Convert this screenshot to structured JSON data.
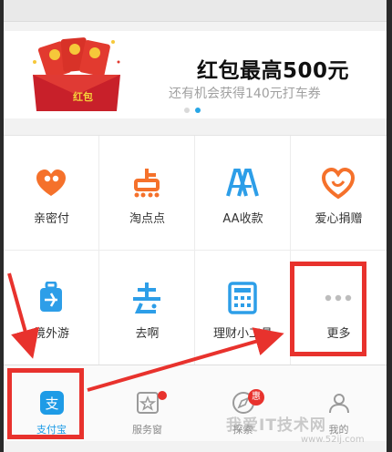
{
  "banner": {
    "title": "红包最高500元",
    "subtitle": "还有机会获得140元打车券",
    "redpack_label": "红包"
  },
  "grid": {
    "items": [
      {
        "label": "亲密付",
        "icon": "heart-people-icon",
        "color": "#f5712b"
      },
      {
        "label": "淘点点",
        "icon": "dianping-icon",
        "color": "#f5712b"
      },
      {
        "label": "AA收款",
        "icon": "aa-icon",
        "color": "#2d9ee8"
      },
      {
        "label": "爱心捐赠",
        "icon": "charity-heart-icon",
        "color": "#f5712b"
      },
      {
        "label": "境外游",
        "icon": "luggage-icon",
        "color": "#2d9ee8"
      },
      {
        "label": "去啊",
        "icon": "qua-icon",
        "color": "#2d9ee8"
      },
      {
        "label": "理财小工具",
        "icon": "calculator-icon",
        "color": "#2d9ee8"
      },
      {
        "label": "更多",
        "icon": "more-dots-icon",
        "color": "#bdbdbd"
      }
    ]
  },
  "tabs": [
    {
      "label": "支付宝",
      "icon": "alipay-icon",
      "active": true
    },
    {
      "label": "服务窗",
      "icon": "service-window-icon"
    },
    {
      "label": "探索",
      "icon": "explore-icon",
      "badge": "惠"
    },
    {
      "label": "我的",
      "icon": "profile-icon"
    }
  ],
  "watermark": {
    "text": "我爱IT技术网",
    "sub": "www.52ij.com"
  },
  "colors": {
    "accent": "#27a6e6",
    "annotation_red": "#e8322d",
    "orange": "#f5712b"
  }
}
